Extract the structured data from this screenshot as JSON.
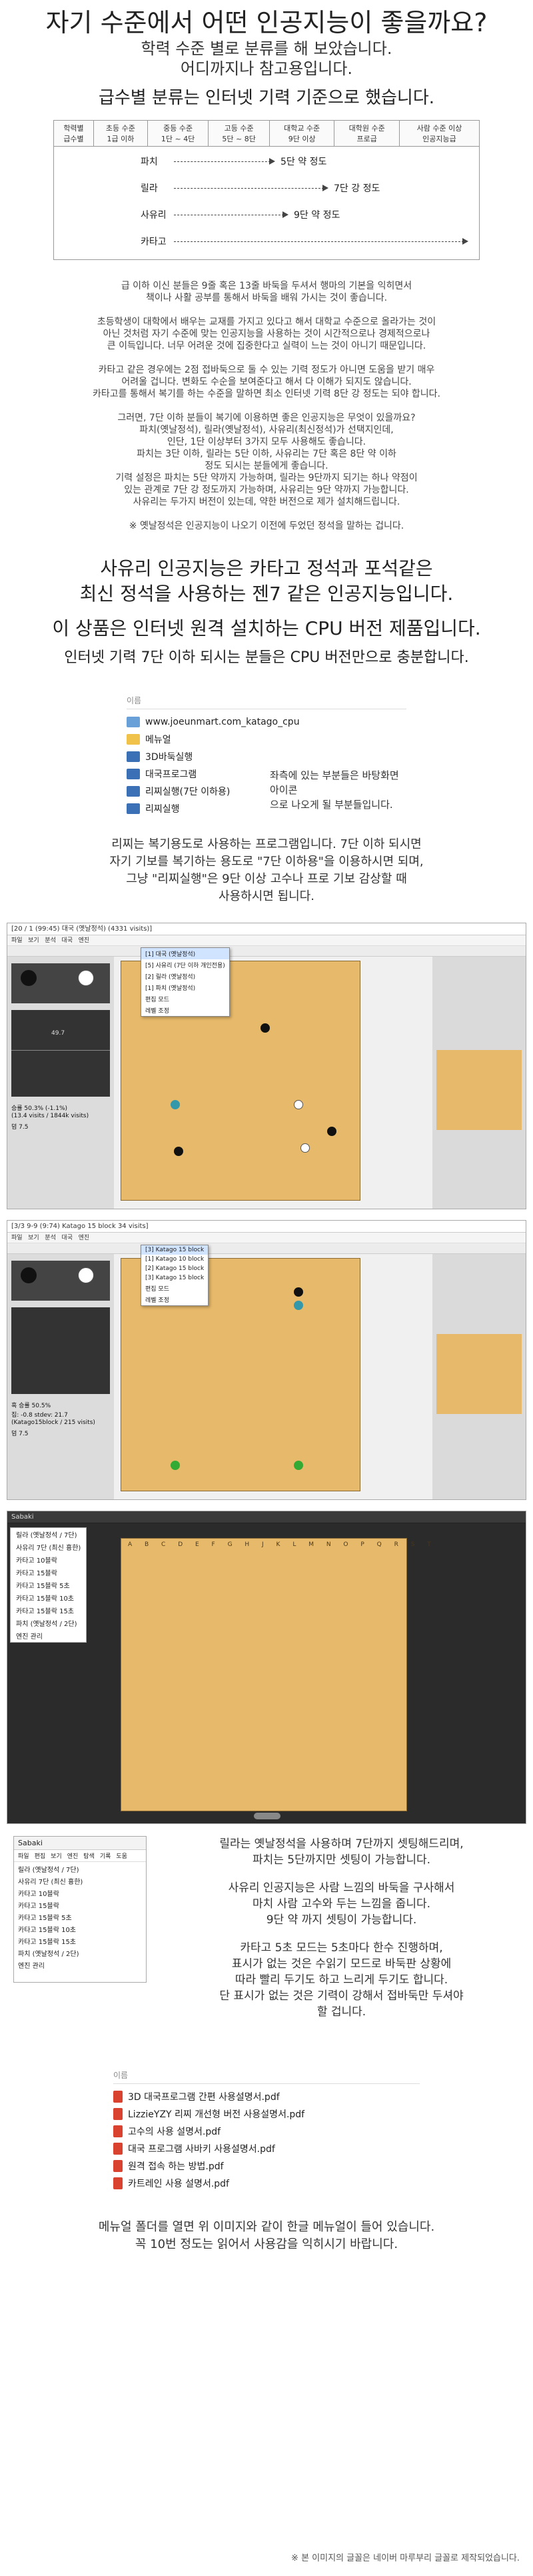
{
  "header": {
    "title": "자기 수준에서 어떤 인공지능이 좋을까요?",
    "sub1": "학력 수준 별로 분류를 해 보았습니다.",
    "sub2": "어디까지나 참고용입니다.",
    "sub3": "급수별 분류는 인터넷 기력 기준으로 했습니다."
  },
  "level_table": {
    "headers": [
      "학력별\n급수별",
      "초등 수준\n1급 이하",
      "중등 수준\n1단 ~ 4단",
      "고등 수준\n5단 ~ 8단",
      "대학교 수준\n9단 이상",
      "대학원 수준\n프로급",
      "사람 수준 이상\n인공지능급"
    ],
    "rows": [
      {
        "name": "파치",
        "text": "5단 약 정도"
      },
      {
        "name": "릴라",
        "text": "7단 강 정도"
      },
      {
        "name": "사유리",
        "text": "9단 약 정도"
      },
      {
        "name": "카타고",
        "text": ""
      }
    ]
  },
  "body1": [
    "급 이하 이신 분들은 9줄 혹은 13줄 바둑을 두셔서 행마의 기본을 익히면서\n책이나 사활 공부를 통해서 바둑을 배워 가시는 것이 좋습니다.",
    "초등학생이 대학에서 배우는 교재를 가지고 있다고 해서 대학교 수준으로 올라가는 것이\n아닌 것처럼 자기 수준에 맞는 인공지능을 사용하는 것이 시간적으로나 경제적으로나\n큰 이득입니다. 너무 어려운 것에 집중한다고 실력이 느는 것이 아니기 때문입니다.",
    "카타고 같은 경우에는 2점 접바둑으로 둘 수 있는 기력 정도가 아니면 도움을 받기 매우\n어려울 겁니다. 변화도 수순을 보여준다고 해서 다 이해가 되지도 않습니다.\n카타고를 통해서 복기를 하는 수준을 말하면 최소 인터넷 기력 8단 강 정도는 되야 합니다.",
    "그러면, 7단 이하 분들이 복기에 이용하면 좋은 인공지능은 무엇이 있을까요?\n파치(옛날정석), 릴라(옛날정석), 사유리(최신정석)가 선택지인데,\n인단, 1단 이상부터 3가지 모두 사용해도 좋습니다.\n파치는 3단 이하, 릴라는 5단 이하, 사유리는 7단 혹은 8단 약 이하\n정도 되시는 분들에게 좋습니다.\n기력 설정은 파치는 5단 약까지 가능하며, 릴라는 9단까지 되기는 하나 약점이\n있는 관계로 7단 강 정도까지 가능하며, 사유리는 9단 약까지 가능합니다.\n사유리는 두가지 버전이 있는데, 약한 버전으로 제가 설치해드립니다.",
    "※ 옛날정석은 인공지능이 나오기 이전에 두었던 정석을 말하는 겁니다."
  ],
  "headline": {
    "line1": "사유리 인공지능은 카타고 정석과 포석같은",
    "line2": "최신 정석을 사용하는 젠7 같은 인공지능입니다.",
    "line3": "이 상품은 인터넷 원격 설치하는 CPU 버전 제품입니다.",
    "line4": "인터넷 기력 7단 이하 되시는 분들은 CPU 버전만으로 충분합니다."
  },
  "filebox1": {
    "header": "이름",
    "items": [
      {
        "name": "www.joeunmart.com_katago_cpu",
        "icon": "link-icon"
      },
      {
        "name": "메뉴얼",
        "icon": "folder-icon"
      },
      {
        "name": "3D바둑실행",
        "icon": "exe-icon"
      },
      {
        "name": "대국프로그램",
        "icon": "exe-icon"
      },
      {
        "name": "리찌실행(7단 이하용)",
        "icon": "exe-icon"
      },
      {
        "name": "리찌실행",
        "icon": "exe-icon"
      }
    ],
    "note": "좌측에 있는 부분들은 바탕화면 아이콘\n으로 나오게 될 부분들입니다."
  },
  "body2": "리찌는 복기용도로 사용하는 프로그램입니다. 7단 이하 되시면\n자기 기보를 복기하는 용도로 \"7단 이하용\"을 이용하시면 되며,\n그냥 \"리찌실행\"은 9단 이상 고수나 프로 기보 감상할 때\n사용하시면 됩니다.",
  "shot1": {
    "title": "[20 / 1 (99:45) 대국 (옛날정석) (4331 visits)]",
    "dropdown": [
      "[5] 사유리 (7단 이하 개인전용)",
      "[2] 릴라 (옛날정석)",
      "[1] 파치 (옛날정석)",
      "편집 모드",
      "레벨 조정"
    ],
    "dropdown_header": "[1] 대국 (옛날정석)",
    "winrate": "승률 50.3% (-1.1%)",
    "stats": "(13.4 visits / 1844k visits)",
    "komi": "덤 7.5",
    "side_value": "49.7"
  },
  "shot2": {
    "title": "[3/3 9-9 (9:74) Katago 15 block 34 visits]",
    "dropdown_header": "[3] Katago 15 block",
    "dropdown": [
      "[1] Katago 10 block",
      "[2] Katago 15 block",
      "[3] Katago 15 block",
      "편집 모드",
      "레벨 조정"
    ],
    "winrate": "흑 승률 50.5%",
    "stats": "집: -0.8 stdev: 21.7",
    "stats2": "(Katago15block / 215 visits)",
    "komi": "덤 7.5"
  },
  "shot3": {
    "title": "Sabaki",
    "menu": [
      "릴라 (옛날정석 / 7단)",
      "사유리 7단 (최신 흉한)",
      "카타고 10블락",
      "카타고 15블락",
      "카타고 15블락 5초",
      "카타고 15블락 10초",
      "카타고 15블락 15초",
      "파치 (옛날정석 / 2단)",
      "엔진 관리"
    ],
    "board_letters": "A B C D E F G H J K L M N O P Q R S T"
  },
  "shot4": {
    "title": "Sabaki",
    "menubar": [
      "파일",
      "편집",
      "보기",
      "엔진",
      "탐색",
      "기록",
      "도움"
    ],
    "menu": [
      "릴라 (옛날정석 / 7단)",
      "사유리 7단 (최신 흉한)",
      "카타고 10블락",
      "카타고 15블락",
      "카타고 15블락 5초",
      "카타고 15블락 10초",
      "카타고 15블락 15초",
      "파치 (옛날정석 / 2단)",
      "엔진 관리"
    ]
  },
  "body3": [
    "릴라는 옛날정석을 사용하며 7단까지 셋팅해드리며,\n파치는 5단까지만 셋팅이 가능합니다.",
    "사유리 인공지능은 사람 느낌의 바둑을 구사해서\n마치 사람 고수와 두는 느낌을 줍니다.\n9단 약 까지 셋팅이 가능합니다.",
    "카타고 5초 모드는 5초마다 한수 진행하며,\n표시가 없는 것은 수읽기 모드로 바둑판 상황에\n따라 빨리 두기도 하고 느리게 두기도 합니다.\n단 표시가 없는 것은 기력이 강해서 접바둑만 두셔야\n할 겁니다."
  ],
  "filebox2": {
    "header": "이름",
    "items": [
      "3D 대국프로그램 간편 사용설명서.pdf",
      "LizzieYZY 리찌 개선형 버전 사용설명서.pdf",
      "고수의 사용 설명서.pdf",
      "대국 프로그램 사바키 사용설명서.pdf",
      "원격 접속 하는 방법.pdf",
      "카트레인 사용 설명서.pdf"
    ]
  },
  "footer": {
    "text": "메뉴얼 폴더를 열면 위 이미지와 같이 한글 메뉴얼이 들어 있습니다.\n꼭 10번 정도는 읽어서 사용감을 익히시기 바랍니다.",
    "note": "※ 본 이미지의 글꼴은 네이버 마루부리 글꼴로 제작되었습니다."
  },
  "colors": {
    "board": "#e7b96a",
    "arrow": "#444444",
    "selection": "#d0e4ff"
  }
}
